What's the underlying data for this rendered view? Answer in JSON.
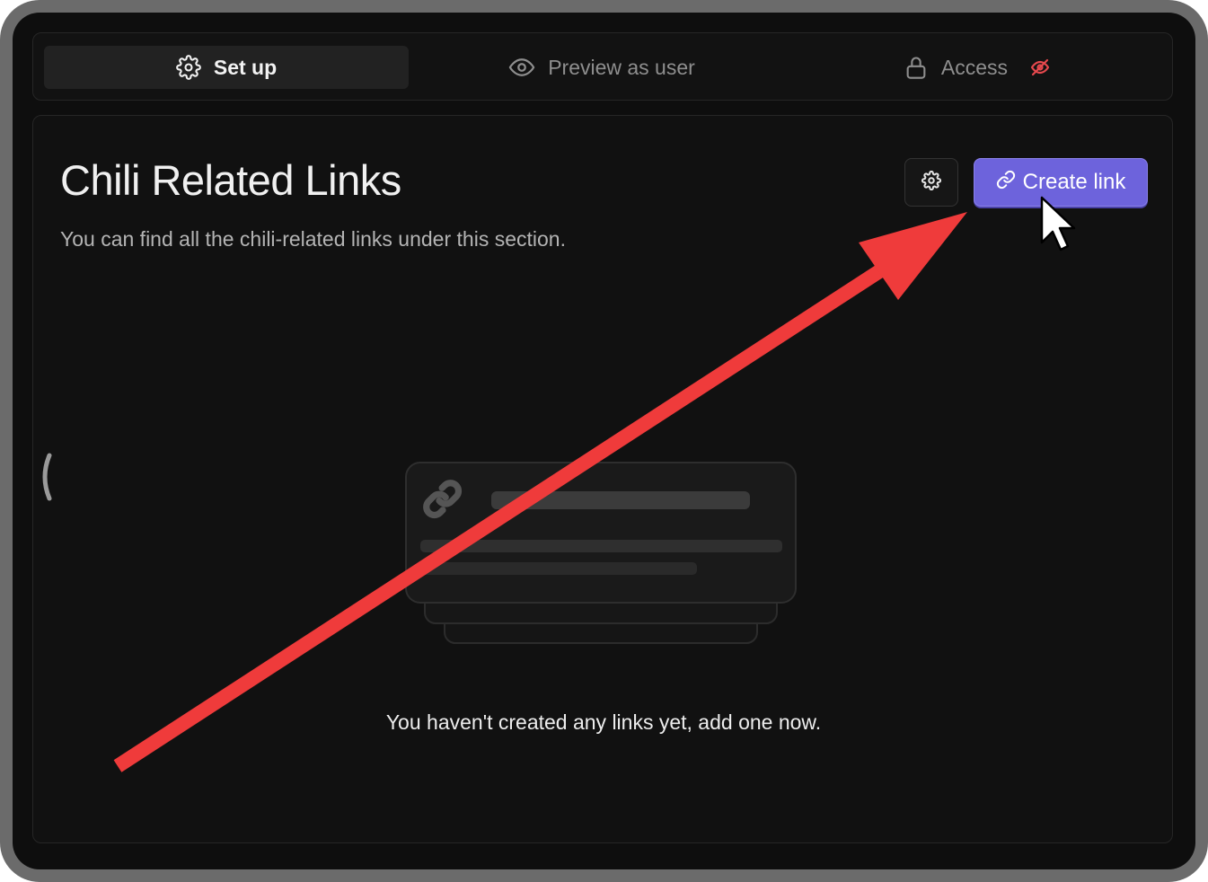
{
  "tabs": [
    {
      "label": "Set up",
      "icon": "gear-icon",
      "active": true
    },
    {
      "label": "Preview as user",
      "icon": "eye-icon",
      "active": false
    },
    {
      "label": "Access",
      "icon": "lock-icon",
      "active": false,
      "badge_icon": "eye-off-icon"
    }
  ],
  "section": {
    "title": "Chili Related Links",
    "description": "You can find all the chili-related links under this section."
  },
  "actions": {
    "settings_icon": "gear-icon",
    "create_label": "Create link",
    "create_icon": "link-icon"
  },
  "empty_state": {
    "message": "You haven't created any links yet, add one now.",
    "illustration_icon": "link-icon"
  },
  "colors": {
    "accent": "#6d63dc",
    "annotation_arrow": "#ef3b3b",
    "access_badge": "#e5484d",
    "background": "#0e0e0e"
  }
}
